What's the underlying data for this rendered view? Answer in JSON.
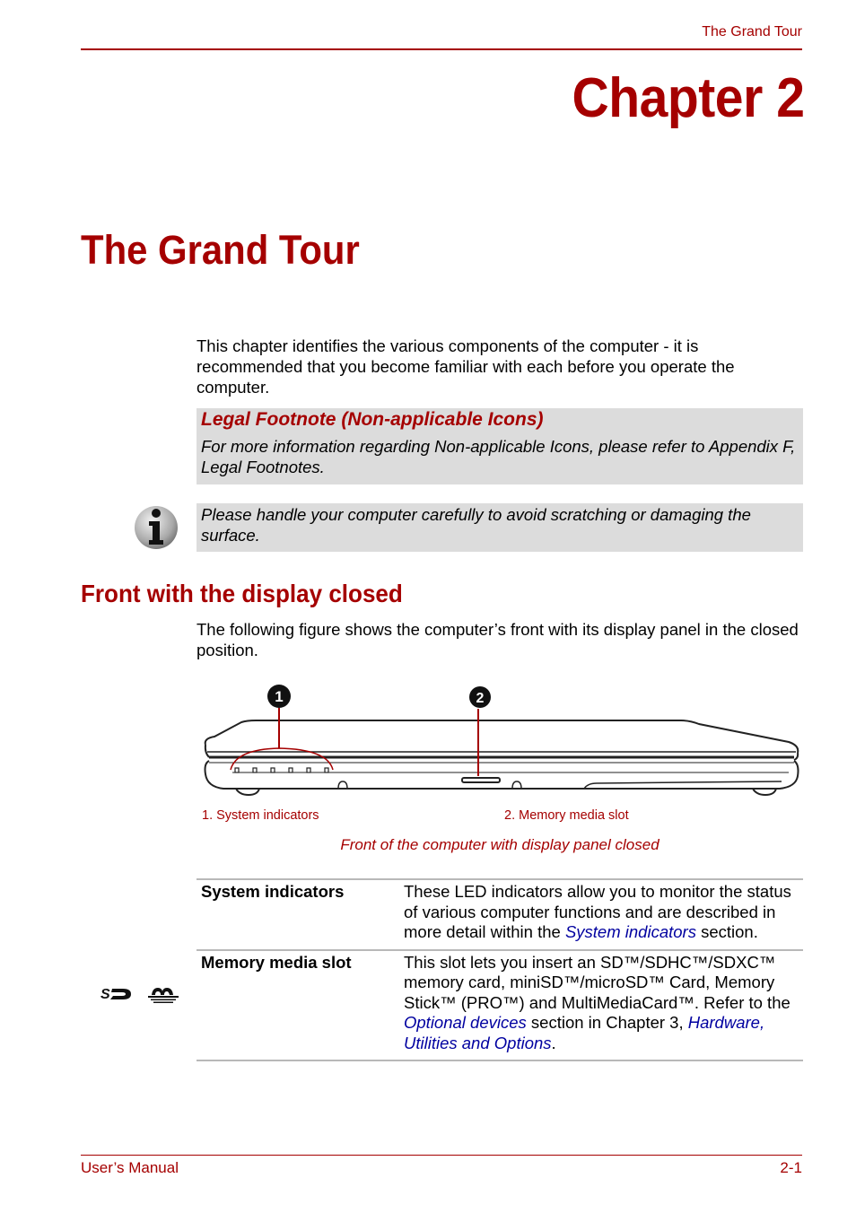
{
  "header": {
    "running_title": "The Grand Tour",
    "chapter_label": "Chapter 2",
    "chapter_title": "The Grand Tour"
  },
  "intro": {
    "text": "This chapter identifies the various components of the computer - it is recommended that you become familiar with each before you operate the computer."
  },
  "legal_note": {
    "title": "Legal Footnote (Non-applicable Icons)",
    "text": "For more information regarding Non-applicable Icons, please refer to Appendix F, Legal Footnotes."
  },
  "info_note": {
    "icon": "info-icon",
    "text": "Please handle your computer carefully to avoid scratching or damaging the surface."
  },
  "section": {
    "title": "Front with the display closed",
    "text": "The following figure shows the computer’s front with its display panel in the closed position."
  },
  "figure": {
    "callouts": [
      {
        "number": "1",
        "label": "1. System indicators"
      },
      {
        "number": "2",
        "label": "2. Memory media slot"
      }
    ],
    "caption": "Front of the computer with display panel closed"
  },
  "spec_table": {
    "rows": [
      {
        "term": "System indicators",
        "def_pre": "These LED indicators allow you to monitor the status of various computer functions and are described in more detail within the ",
        "link1": "System indicators",
        "def_mid": " section.",
        "link2": "",
        "def_post": ""
      },
      {
        "term": "Memory media slot",
        "icons": [
          "sd-card-icon",
          "memory-stick-icon"
        ],
        "def_pre": "This slot lets you insert an SD™/SDHC™/SDXC™ memory card, miniSD™/microSD™ Card, Memory Stick™ (PRO™) and MultiMediaCard™. Refer to the ",
        "link1": "Optional devices",
        "def_mid": " section in Chapter 3, ",
        "link2": "Hardware, Utilities and Options",
        "def_post": "."
      }
    ]
  },
  "footer": {
    "left": "User’s Manual",
    "right": "2-1"
  },
  "colors": {
    "accent": "#a50000",
    "link": "#0000a0",
    "note_bg": "#dcdcdc"
  }
}
